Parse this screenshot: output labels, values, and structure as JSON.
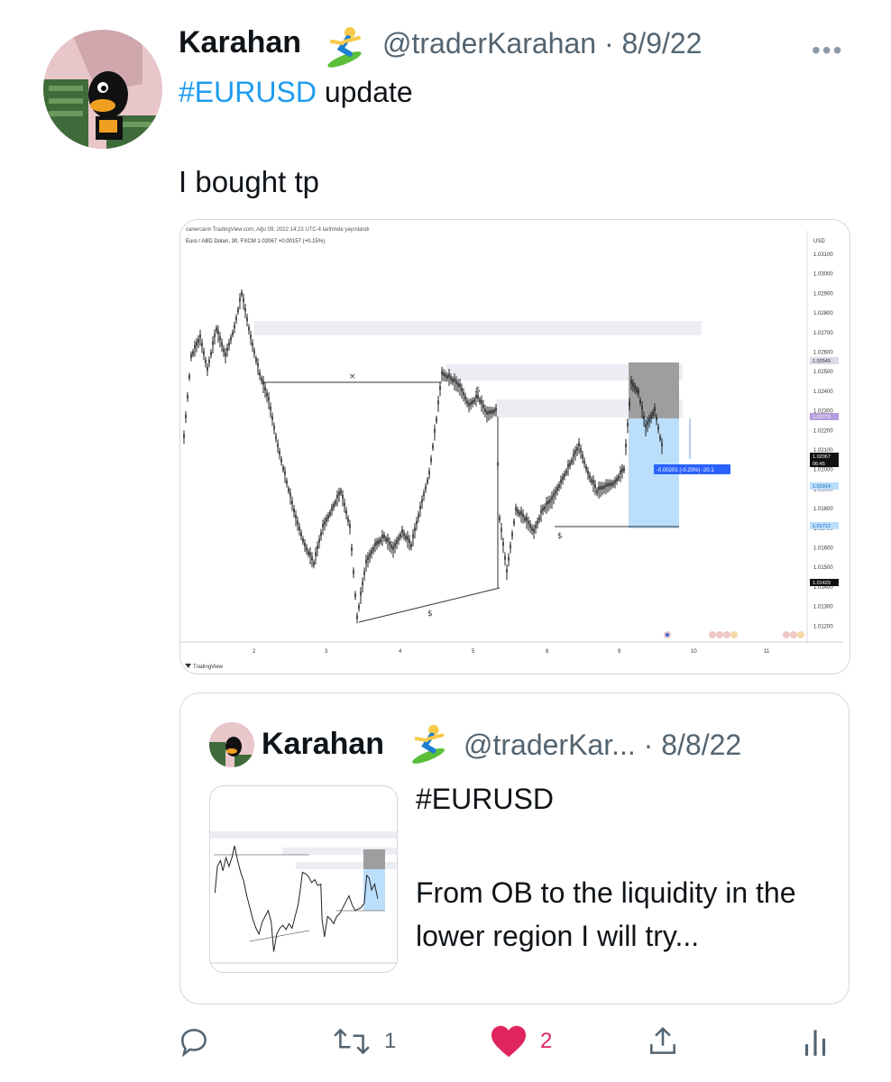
{
  "tweet": {
    "author_name": "Karahan",
    "author_handle": "@traderKarahan",
    "date": "8/9/22",
    "separator": "·",
    "more_label": "•••",
    "hashtag": "#EURUSD",
    "hashtag_suffix": " update",
    "text": "I bought tp"
  },
  "chart": {
    "header_line": "canercann TradingView.com, Ağu 09, 2022 14:23 UTC-4 tarihinde yayınlandı",
    "symbol_line": "Euro / ABD Doları, 30, FXCM 1.02067 +0.00157 (+0.15%)",
    "currency": "USD",
    "price_levels": [
      "1.03100",
      "1.03000",
      "1.02900",
      "1.02800",
      "1.02700",
      "1.02600",
      "1.02500",
      "1.02400",
      "1.02300",
      "1.02200",
      "1.02100",
      "1.02000",
      "1.01900",
      "1.01800",
      "1.01700",
      "1.01600",
      "1.01500",
      "1.01400",
      "1.01300",
      "1.01200"
    ],
    "price_tags": [
      {
        "label": "1.02549",
        "color": "#d9dbe4",
        "text_color": "#333"
      },
      {
        "label": "1.02270",
        "color": "#b39ddb",
        "text_color": "#fff"
      },
      {
        "label": "1.02067",
        "color": "#111111",
        "text_color": "#fff"
      },
      {
        "label": "06:45",
        "color": "#111111",
        "text_color": "#fff"
      },
      {
        "label": "1.01914",
        "color": "#bbdefb",
        "text_color": "#1565c0"
      },
      {
        "label": "1.01712",
        "color": "#bbdefb",
        "text_color": "#1565c0"
      },
      {
        "label": "1.01429",
        "color": "#111111",
        "text_color": "#fff"
      }
    ],
    "x_ticks": [
      "2",
      "3",
      "4",
      "5",
      "8",
      "9",
      "10",
      "11"
    ],
    "position_label": "-0.00201 (-0.20%) -20.1",
    "markers": [
      "×",
      "$",
      "$",
      "$"
    ],
    "footer": "TradingView",
    "colors": {
      "candle": "#222222",
      "zone": "#ecedf3",
      "stop_zone": "#9e9e9e",
      "target_zone": "#bbdefb",
      "accent": "#2962ff"
    }
  },
  "quoted": {
    "author_name": "Karahan",
    "author_handle": "@traderKar...",
    "date": "8/8/22",
    "separator": "·",
    "hashtag": "#EURUSD",
    "text": "From OB to the liquidity in the lower region I will try..."
  },
  "actions": {
    "reply_count": "",
    "retweet_count": "1",
    "like_count": "2",
    "like_color": "#e0245e"
  }
}
